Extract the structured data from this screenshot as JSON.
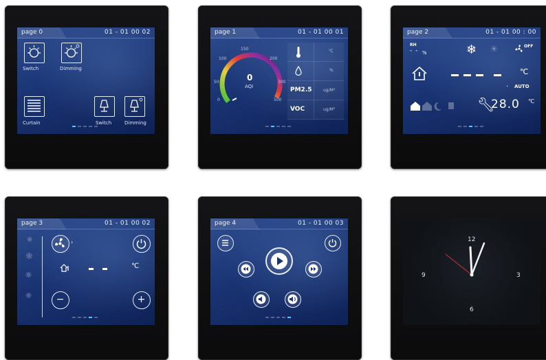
{
  "pages": [
    {
      "title": "page 0",
      "datetime": "01 - 01  00   02",
      "labels": {
        "switch1": "Switch",
        "dimming1": "Dimming",
        "curtain": "Curtain",
        "switch2": "Switch",
        "dimming2": "Dimming"
      }
    },
    {
      "title": "page 1",
      "datetime": "01 - 01  00   01",
      "aqi_value": "0",
      "aqi_label": "AQI",
      "gauge_ticks": [
        "0",
        "50",
        "100",
        "150",
        "200",
        "300",
        "500"
      ],
      "readings": [
        {
          "name": "thermometer-icon",
          "unit": "℃"
        },
        {
          "name": "humidity-icon",
          "unit": "%"
        },
        {
          "name": "PM2.5",
          "unit": "ug/M³"
        },
        {
          "name": "VOC",
          "unit": "ug/M³"
        }
      ]
    },
    {
      "title": "page 2",
      "datetime": "01 - 01  00 : 00",
      "rh_label": "RH",
      "rh_unit": "%",
      "fan_off": "OFF",
      "temp_unit": "℃",
      "mode": "AUTO",
      "set_temp": "28.0",
      "set_temp_unit": "℃"
    },
    {
      "title": "page 3",
      "datetime": "01 - 01  00   02",
      "temp_unit": "℃",
      "minus": "−",
      "plus": "+"
    },
    {
      "title": "page 4",
      "datetime": "01 - 01  00   03"
    },
    {
      "clock": {
        "n12": "12",
        "n3": "3",
        "n6": "6",
        "n9": "9"
      }
    }
  ],
  "colors": {
    "accent": "#58c8ff",
    "screen": "#1a3474",
    "clock_second_hand": "#d0303a"
  }
}
